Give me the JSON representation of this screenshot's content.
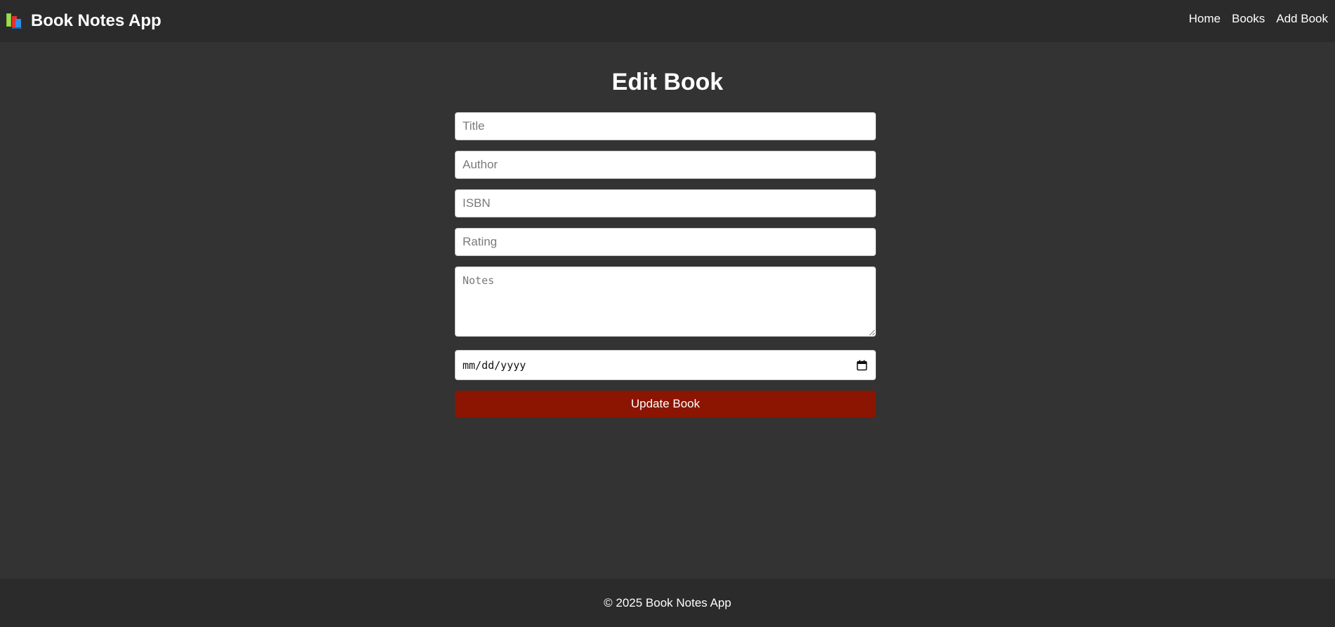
{
  "navbar": {
    "logo_icon": "books-icon",
    "brand": "Book Notes App",
    "links": [
      "Home",
      "Books",
      "Add Book"
    ]
  },
  "main": {
    "title": "Edit Book",
    "form": {
      "title_placeholder": "Title",
      "author_placeholder": "Author",
      "isbn_placeholder": "ISBN",
      "rating_placeholder": "Rating",
      "notes_placeholder": "Notes",
      "date_value": "mm/dd/yyyy",
      "date_icon": "calendar-icon",
      "submit_label": "Update Book"
    }
  },
  "footer": {
    "text": "© 2025 Book Notes App"
  },
  "colors": {
    "page_background": "#333333",
    "bar_background": "#2b2b2b",
    "button_accent": "#8b1500",
    "text": "#ffffff"
  }
}
